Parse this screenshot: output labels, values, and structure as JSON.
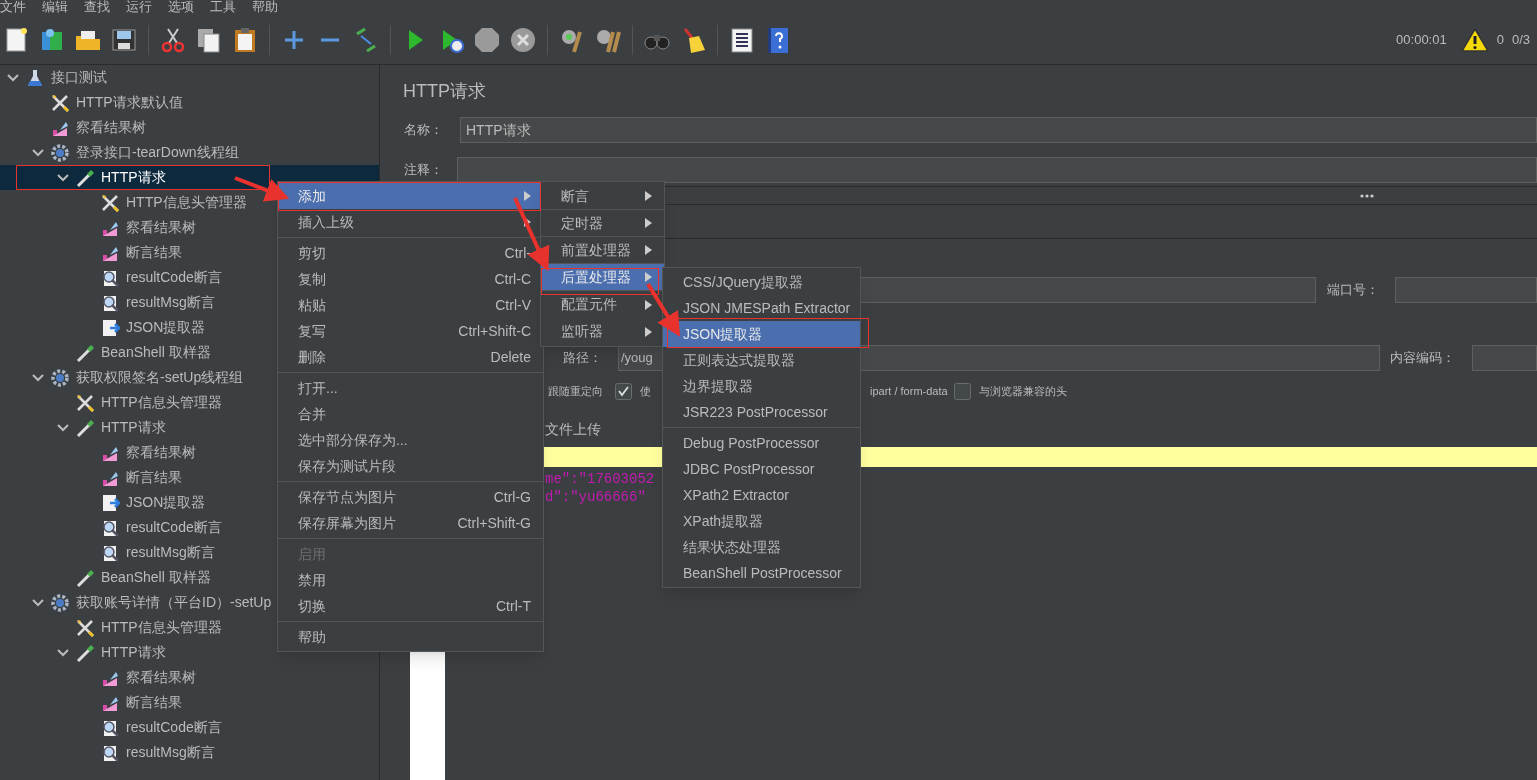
{
  "menu_bar": [
    "文件",
    "编辑",
    "查找",
    "运行",
    "选项",
    "工具",
    "帮助"
  ],
  "toolbar": {
    "timer": "00:00:01",
    "warning_count": "0",
    "threads": "0/3"
  },
  "tree": [
    {
      "label": "接口测试",
      "kind": "test-plan",
      "expanded": true,
      "selected": false,
      "children": [
        {
          "label": "HTTP请求默认值",
          "kind": "config",
          "selected": false
        },
        {
          "label": "察看结果树",
          "kind": "listener",
          "selected": false
        },
        {
          "label": "登录接口-tearDown线程组",
          "kind": "thread-group",
          "expanded": true,
          "selected": false,
          "children": [
            {
              "label": "HTTP请求",
              "kind": "sampler",
              "expanded": true,
              "selected": true,
              "children": [
                {
                  "label": "HTTP信息头管理器",
                  "kind": "config",
                  "selected": false
                },
                {
                  "label": "察看结果树",
                  "kind": "listener",
                  "selected": false
                },
                {
                  "label": "断言结果",
                  "kind": "listener",
                  "selected": false
                },
                {
                  "label": "resultCode断言",
                  "kind": "assertion",
                  "selected": false
                },
                {
                  "label": "resultMsg断言",
                  "kind": "assertion",
                  "selected": false
                },
                {
                  "label": "JSON提取器",
                  "kind": "extractor",
                  "selected": false
                }
              ]
            },
            {
              "label": "BeanShell 取样器",
              "kind": "sampler",
              "selected": false
            }
          ]
        },
        {
          "label": "获取权限签名-setUp线程组",
          "kind": "thread-group",
          "expanded": true,
          "selected": false,
          "children": [
            {
              "label": "HTTP信息头管理器",
              "kind": "config",
              "selected": false
            },
            {
              "label": "HTTP请求",
              "kind": "sampler",
              "expanded": true,
              "selected": false,
              "children": [
                {
                  "label": "察看结果树",
                  "kind": "listener",
                  "selected": false
                },
                {
                  "label": "断言结果",
                  "kind": "listener",
                  "selected": false
                },
                {
                  "label": "JSON提取器",
                  "kind": "extractor",
                  "selected": false
                },
                {
                  "label": "resultCode断言",
                  "kind": "assertion",
                  "selected": false
                },
                {
                  "label": "resultMsg断言",
                  "kind": "assertion",
                  "selected": false
                }
              ]
            },
            {
              "label": "BeanShell 取样器",
              "kind": "sampler",
              "selected": false
            }
          ]
        },
        {
          "label": "获取账号详情（平台ID）-setUp",
          "kind": "thread-group",
          "expanded": true,
          "selected": false,
          "children": [
            {
              "label": "HTTP信息头管理器",
              "kind": "config",
              "selected": false
            },
            {
              "label": "HTTP请求",
              "kind": "sampler",
              "expanded": true,
              "selected": false,
              "children": [
                {
                  "label": "察看结果树",
                  "kind": "listener",
                  "selected": false
                },
                {
                  "label": "断言结果",
                  "kind": "listener",
                  "selected": false
                },
                {
                  "label": "resultCode断言",
                  "kind": "assertion",
                  "selected": false
                },
                {
                  "label": "resultMsg断言",
                  "kind": "assertion",
                  "selected": false
                }
              ]
            }
          ]
        }
      ]
    }
  ],
  "panel": {
    "title": "HTTP请求",
    "name_label": "名称：",
    "name_value": "HTTP请求",
    "comment_label": "注释：",
    "port_label": "端口号：",
    "path_label": "路径：",
    "path_value": "/youg",
    "encoding_label": "内容编码：",
    "options": [
      {
        "kind": "label",
        "label": "跟随重定向"
      },
      {
        "kind": "checkbox",
        "checked": true,
        "label": "使"
      },
      {
        "kind": "label",
        "label": "ipart / form-data"
      },
      {
        "kind": "checkbox",
        "checked": false,
        "label": "与浏览器兼容的头"
      }
    ],
    "upload_label": "文件上传",
    "code_lines": [
      "me\":\"17603052",
      "d\":\"yu66666\""
    ]
  },
  "context_menu": [
    {
      "kind": "item",
      "label": "添加",
      "submenu": true,
      "selected": true,
      "disabled": false
    },
    {
      "kind": "item",
      "label": "插入上级",
      "submenu": true,
      "selected": false,
      "disabled": false
    },
    {
      "kind": "separator"
    },
    {
      "kind": "item",
      "label": "剪切",
      "shortcut": "Ctrl-",
      "selected": false,
      "disabled": false
    },
    {
      "kind": "item",
      "label": "复制",
      "shortcut": "Ctrl-C",
      "selected": false,
      "disabled": false
    },
    {
      "kind": "item",
      "label": "粘贴",
      "shortcut": "Ctrl-V",
      "selected": false,
      "disabled": false
    },
    {
      "kind": "item",
      "label": "复写",
      "shortcut": "Ctrl+Shift-C",
      "selected": false,
      "disabled": false
    },
    {
      "kind": "item",
      "label": "删除",
      "shortcut": "Delete",
      "selected": false,
      "disabled": false
    },
    {
      "kind": "separator"
    },
    {
      "kind": "item",
      "label": "打开...",
      "selected": false,
      "disabled": false
    },
    {
      "kind": "item",
      "label": "合并",
      "selected": false,
      "disabled": false
    },
    {
      "kind": "item",
      "label": "选中部分保存为...",
      "selected": false,
      "disabled": false
    },
    {
      "kind": "item",
      "label": "保存为测试片段",
      "selected": false,
      "disabled": false
    },
    {
      "kind": "separator"
    },
    {
      "kind": "item",
      "label": "保存节点为图片",
      "shortcut": "Ctrl-G",
      "selected": false,
      "disabled": false
    },
    {
      "kind": "item",
      "label": "保存屏幕为图片",
      "shortcut": "Ctrl+Shift-G",
      "selected": false,
      "disabled": false
    },
    {
      "kind": "separator"
    },
    {
      "kind": "item",
      "label": "启用",
      "selected": false,
      "disabled": true
    },
    {
      "kind": "item",
      "label": "禁用",
      "selected": false,
      "disabled": false
    },
    {
      "kind": "item",
      "label": "切换",
      "shortcut": "Ctrl-T",
      "selected": false,
      "disabled": false
    },
    {
      "kind": "separator"
    },
    {
      "kind": "item",
      "label": "帮助",
      "selected": false,
      "disabled": false
    }
  ],
  "add_submenu": [
    {
      "kind": "item",
      "label": "断言",
      "submenu": true,
      "selected": false
    },
    {
      "kind": "item",
      "label": "定时器",
      "submenu": true,
      "selected": false
    },
    {
      "kind": "item",
      "label": "前置处理器",
      "submenu": true,
      "selected": false
    },
    {
      "kind": "item",
      "label": "后置处理器",
      "submenu": true,
      "selected": true
    },
    {
      "kind": "item",
      "label": "配置元件",
      "submenu": true,
      "selected": false
    },
    {
      "kind": "item",
      "label": "监听器",
      "submenu": true,
      "selected": false
    }
  ],
  "postprocessor_submenu": [
    {
      "kind": "item",
      "label": "CSS/JQuery提取器",
      "selected": false
    },
    {
      "kind": "item",
      "label": "JSON JMESPath Extractor",
      "selected": false
    },
    {
      "kind": "item",
      "label": "JSON提取器",
      "selected": true
    },
    {
      "kind": "item",
      "label": "正则表达式提取器",
      "selected": false
    },
    {
      "kind": "item",
      "label": "边界提取器",
      "selected": false
    },
    {
      "kind": "item",
      "label": "JSR223 PostProcessor",
      "selected": false
    },
    {
      "kind": "separator"
    },
    {
      "kind": "item",
      "label": "Debug PostProcessor",
      "selected": false
    },
    {
      "kind": "item",
      "label": "JDBC PostProcessor",
      "selected": false
    },
    {
      "kind": "item",
      "label": "XPath2 Extractor",
      "selected": false
    },
    {
      "kind": "item",
      "label": "XPath提取器",
      "selected": false
    },
    {
      "kind": "item",
      "label": "结果状态处理器",
      "selected": false
    },
    {
      "kind": "item",
      "label": "BeanShell PostProcessor",
      "selected": false
    }
  ]
}
